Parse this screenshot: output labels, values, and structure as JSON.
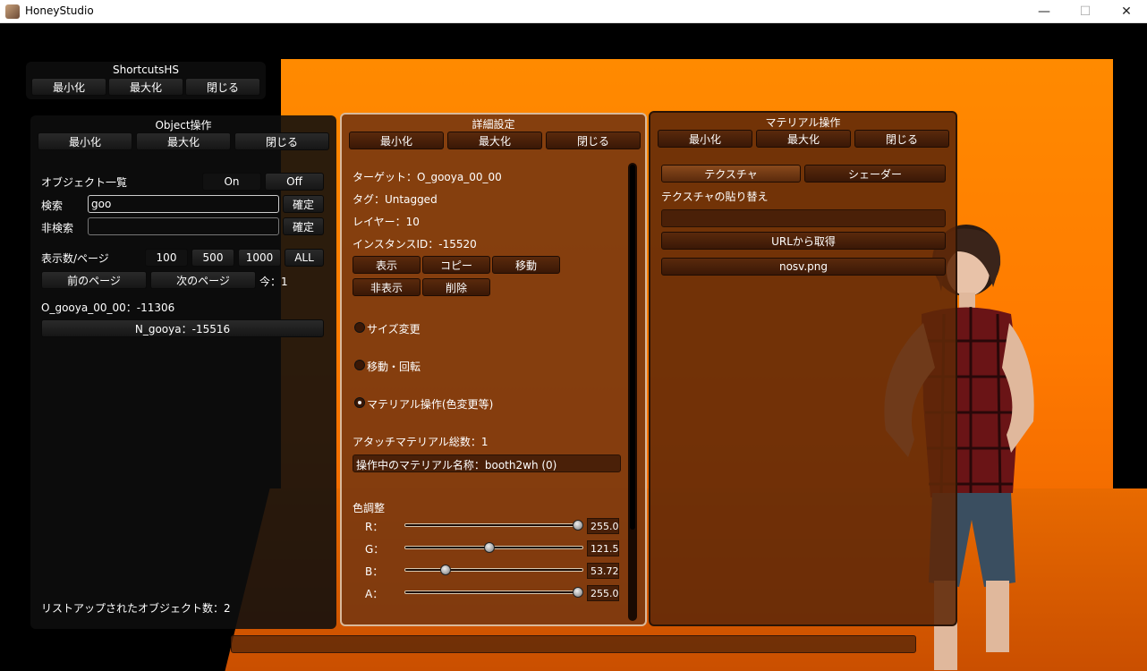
{
  "window": {
    "title": "HoneyStudio",
    "minimize": "—",
    "maximize": "☐",
    "close": "✕"
  },
  "shortcuts": {
    "title": "ShortcutsHS",
    "min": "最小化",
    "max": "最大化",
    "close": "閉じる"
  },
  "object_panel": {
    "title": "Object操作",
    "min": "最小化",
    "max": "最大化",
    "close": "閉じる",
    "list_label": "オブジェクト一覧",
    "on": "On",
    "off": "Off",
    "search_label": "検索",
    "search_value": "goo",
    "confirm": "確定",
    "exclude_label": "非検索",
    "exclude_value": "",
    "confirm2": "確定",
    "per_page_label": "表示数/ページ",
    "opt100": "100",
    "opt500": "500",
    "opt1000": "1000",
    "optall": "ALL",
    "prev_page": "前のページ",
    "next_page": "次のページ",
    "current_page": "今：1",
    "selected_object": "O_gooya_00_00：-11306",
    "list_item": "N_gooya：-15516",
    "count_label": "リストアップされたオブジェクト数：2"
  },
  "detail_panel": {
    "title": "詳細設定",
    "min": "最小化",
    "max": "最大化",
    "close": "閉じる",
    "target": "ターゲット：O_gooya_00_00",
    "tag": "タグ：Untagged",
    "layer": "レイヤー：10",
    "instance": "インスタンスID：-15520",
    "show": "表示",
    "copy": "コピー",
    "move": "移動",
    "hide": "非表示",
    "delete": "削除",
    "size_change": "サイズ変更",
    "move_rotate": "移動・回転",
    "material_op": "マテリアル操作(色変更等)",
    "attach_total": "アタッチマテリアル総数：1",
    "current_material": "操作中のマテリアル名称：booth2wh (0)",
    "color_adjust": "色調整",
    "channels": [
      {
        "label": "R：",
        "value": "255.0",
        "frac": 1.0
      },
      {
        "label": "G：",
        "value": "121.5",
        "frac": 0.476
      },
      {
        "label": "B：",
        "value": "53.72",
        "frac": 0.211
      },
      {
        "label": "A：",
        "value": "255.0",
        "frac": 1.0
      }
    ]
  },
  "material_panel": {
    "title": "マテリアル操作",
    "min": "最小化",
    "max": "最大化",
    "close": "閉じる",
    "texture_tab": "テクスチャ",
    "shader_tab": "シェーダー",
    "replace_label": "テクスチャの貼り替え",
    "url_value": "",
    "fetch_url": "URLから取得",
    "file_name": "nosv.png"
  }
}
